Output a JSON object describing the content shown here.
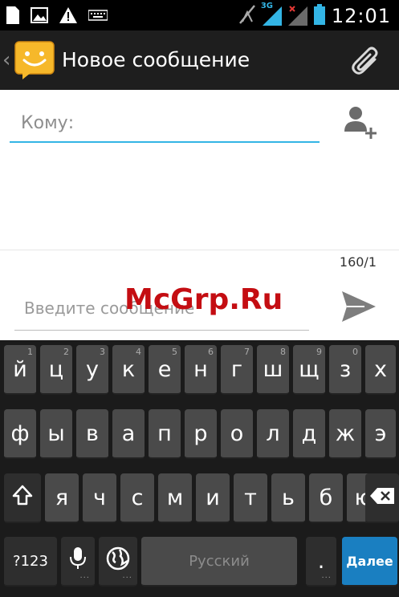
{
  "status_bar": {
    "time": "12:01",
    "network_label": "3G",
    "icons": [
      "sim-card-icon",
      "image-icon",
      "warning-icon",
      "keyboard-icon",
      "no-signal-icon",
      "signal-icon",
      "signal-x-icon",
      "battery-icon"
    ]
  },
  "action_bar": {
    "title": "Новое сообщение",
    "back_glyph": "‹",
    "icons": [
      "messaging-app-icon",
      "attachment-icon"
    ]
  },
  "compose": {
    "to_placeholder": "Кому:",
    "char_counter": "160/1",
    "message_placeholder": "Введите сообщение",
    "icons": [
      "add-contact-icon",
      "send-icon"
    ]
  },
  "watermark": {
    "text": "McGrp.Ru"
  },
  "keyboard": {
    "row1": [
      {
        "label": "й",
        "hint": "1"
      },
      {
        "label": "ц",
        "hint": "2"
      },
      {
        "label": "у",
        "hint": "3"
      },
      {
        "label": "к",
        "hint": "4"
      },
      {
        "label": "е",
        "hint": "5"
      },
      {
        "label": "н",
        "hint": "6"
      },
      {
        "label": "г",
        "hint": "7"
      },
      {
        "label": "ш",
        "hint": "8"
      },
      {
        "label": "щ",
        "hint": "9"
      },
      {
        "label": "з",
        "hint": "0"
      },
      {
        "label": "х",
        "hint": ""
      }
    ],
    "row2": [
      "ф",
      "ы",
      "в",
      "а",
      "п",
      "р",
      "о",
      "л",
      "д",
      "ж",
      "э"
    ],
    "row3": [
      "я",
      "ч",
      "с",
      "м",
      "и",
      "т",
      "ь",
      "б",
      "ю"
    ],
    "numbers_key": "?123",
    "space_label": "Русский",
    "period_key": ".",
    "action_key": "Далее",
    "icons": [
      "shift-icon",
      "backspace-icon",
      "microphone-icon",
      "globe-icon"
    ]
  },
  "colors": {
    "accent": "#33b5e5",
    "action_key": "#1a7fc1",
    "watermark": "#c40d12"
  }
}
